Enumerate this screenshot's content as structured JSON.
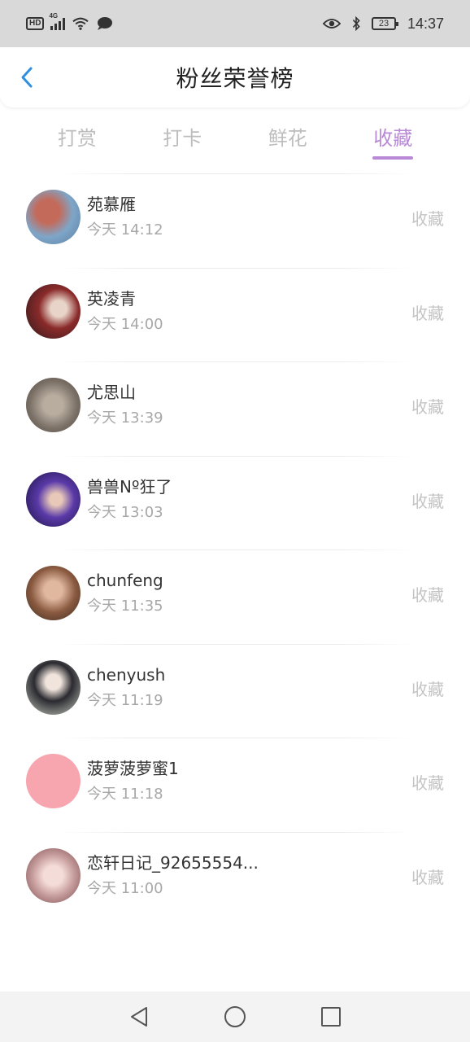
{
  "status_bar": {
    "hd": "HD",
    "network": "4G",
    "battery": "23",
    "time": "14:37"
  },
  "header": {
    "title": "粉丝荣誉榜"
  },
  "tabs": [
    {
      "label": "打赏",
      "active": false
    },
    {
      "label": "打卡",
      "active": false
    },
    {
      "label": "鲜花",
      "active": false
    },
    {
      "label": "收藏",
      "active": true
    }
  ],
  "fans": [
    {
      "name": "苑慕雁",
      "time": "今天 14:12",
      "action": "收藏",
      "avatar_color": "#7ea6c8"
    },
    {
      "name": "英凌青",
      "time": "今天 14:00",
      "action": "收藏",
      "avatar_color": "#7a2a2a"
    },
    {
      "name": "尤思山",
      "time": "今天 13:39",
      "action": "收藏",
      "avatar_color": "#8c8176"
    },
    {
      "name": "兽兽Nº狂了",
      "time": "今天 13:03",
      "action": "收藏",
      "avatar_color": "#3b2a7a"
    },
    {
      "name": "chunfeng",
      "time": "今天 11:35",
      "action": "收藏",
      "avatar_color": "#6b4a3a"
    },
    {
      "name": "chenyush",
      "time": "今天 11:19",
      "action": "收藏",
      "avatar_color": "#4a4a52"
    },
    {
      "name": "菠萝菠萝蜜1",
      "time": "今天 11:18",
      "action": "收藏",
      "avatar_color": "#f7a6b0"
    },
    {
      "name": "恋轩日记_92655554...",
      "time": "今天 11:00",
      "action": "收藏",
      "avatar_color": "#c49a9a"
    }
  ],
  "colors": {
    "accent": "#b989d8",
    "back_arrow": "#2f8fe0"
  }
}
